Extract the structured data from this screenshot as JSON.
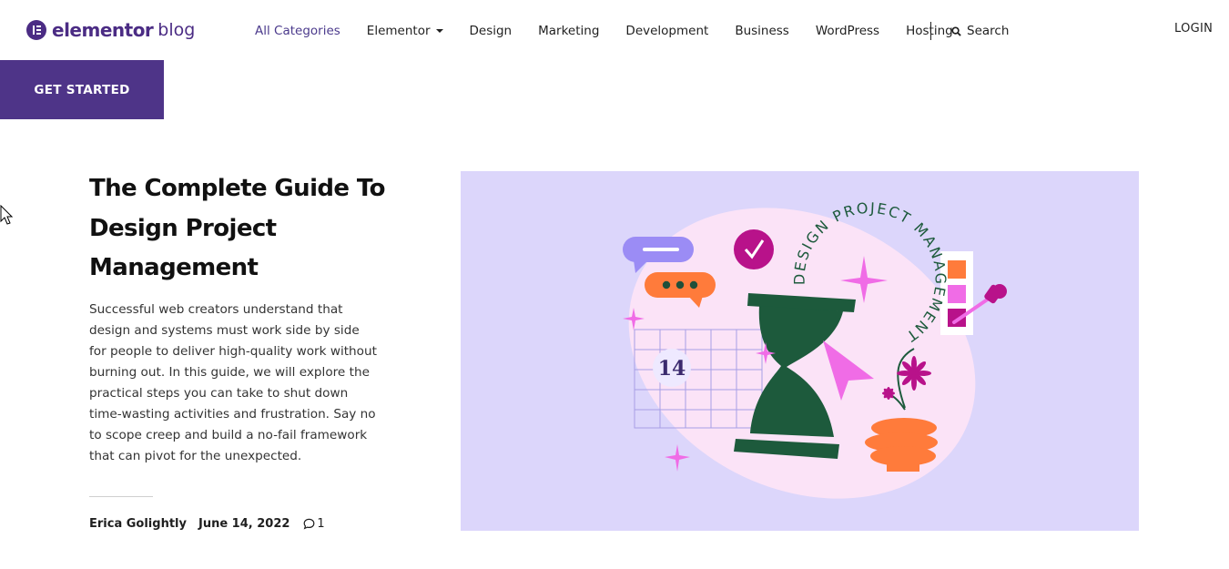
{
  "brand": {
    "name": "elementor",
    "suffix": "blog",
    "color": "#4b2c84"
  },
  "nav": {
    "items": [
      {
        "label": "All Categories",
        "active": true
      },
      {
        "label": "Elementor",
        "dropdown": true
      },
      {
        "label": "Design"
      },
      {
        "label": "Marketing"
      },
      {
        "label": "Development"
      },
      {
        "label": "Business"
      },
      {
        "label": "WordPress"
      },
      {
        "label": "Hosting"
      }
    ],
    "search_label": "Search",
    "login_label": "LOGIN"
  },
  "cta": {
    "label": "GET STARTED",
    "color": "#4e3488"
  },
  "article": {
    "title": "The Complete Guide To Design Project Management",
    "excerpt": "Successful web creators understand that design and systems must work side by side for people to deliver high-quality work without burning out. In this guide, we will explore the practical steps you can take to shut down time-wasting activities and frustration. Say no to scope creep and build a no-fail framework that can pivot for the unexpected.",
    "author": "Erica Golightly",
    "date": "June 14, 2022",
    "comment_count": "1"
  },
  "featured_image": {
    "curved_text": "DESIGN PROJECT MANAGEMENT",
    "calendar_day": "14",
    "background": "#dcd6fb"
  }
}
